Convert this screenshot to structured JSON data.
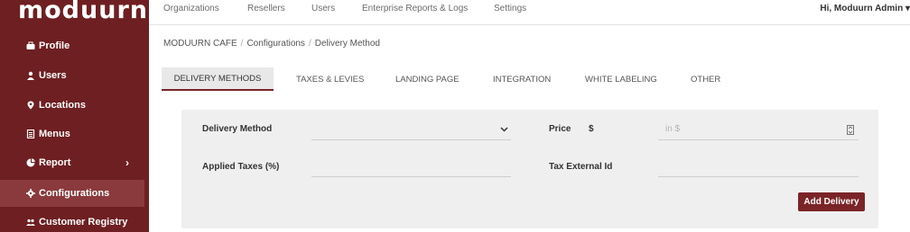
{
  "app": {
    "logo": "moduurn"
  },
  "sidebar": {
    "items": [
      {
        "label": "Profile",
        "icon": "briefcase-icon"
      },
      {
        "label": "Users",
        "icon": "user-icon"
      },
      {
        "label": "Locations",
        "icon": "map-pin-icon"
      },
      {
        "label": "Menus",
        "icon": "document-icon"
      },
      {
        "label": "Report",
        "icon": "pie-chart-icon",
        "chevron": "›"
      },
      {
        "label": "Configurations",
        "icon": "gear-icon"
      },
      {
        "label": "Customer Registry",
        "icon": "users-icon"
      }
    ],
    "active_index": 5
  },
  "topnav": {
    "items": [
      "Organizations",
      "Resellers",
      "Users",
      "Enterprise Reports & Logs",
      "Settings"
    ],
    "user_label": "Hi, Moduurn Admin",
    "user_caret": "▾"
  },
  "breadcrumb": [
    "MODUURN CAFE",
    "Configurations",
    "Delivery Method"
  ],
  "breadcrumb_sep": "/",
  "tabs": [
    "DELIVERY METHODS",
    "TAXES & LEVIES",
    "LANDING PAGE",
    "INTEGRATION",
    "WHITE LABELING",
    "OTHER"
  ],
  "form": {
    "delivery_method_label": "Delivery Method",
    "delivery_method_value": "",
    "price_label": "Price",
    "currency_symbol": "$",
    "price_placeholder": "in $",
    "applied_taxes_label": "Applied Taxes (%)",
    "applied_taxes_value": "",
    "tax_external_id_label": "Tax External Id",
    "tax_external_id_value": "",
    "add_button": "Add Delivery"
  },
  "colors": {
    "sidebar": "#6e1f22",
    "accent": "#7b2428",
    "panel": "#efefef"
  }
}
